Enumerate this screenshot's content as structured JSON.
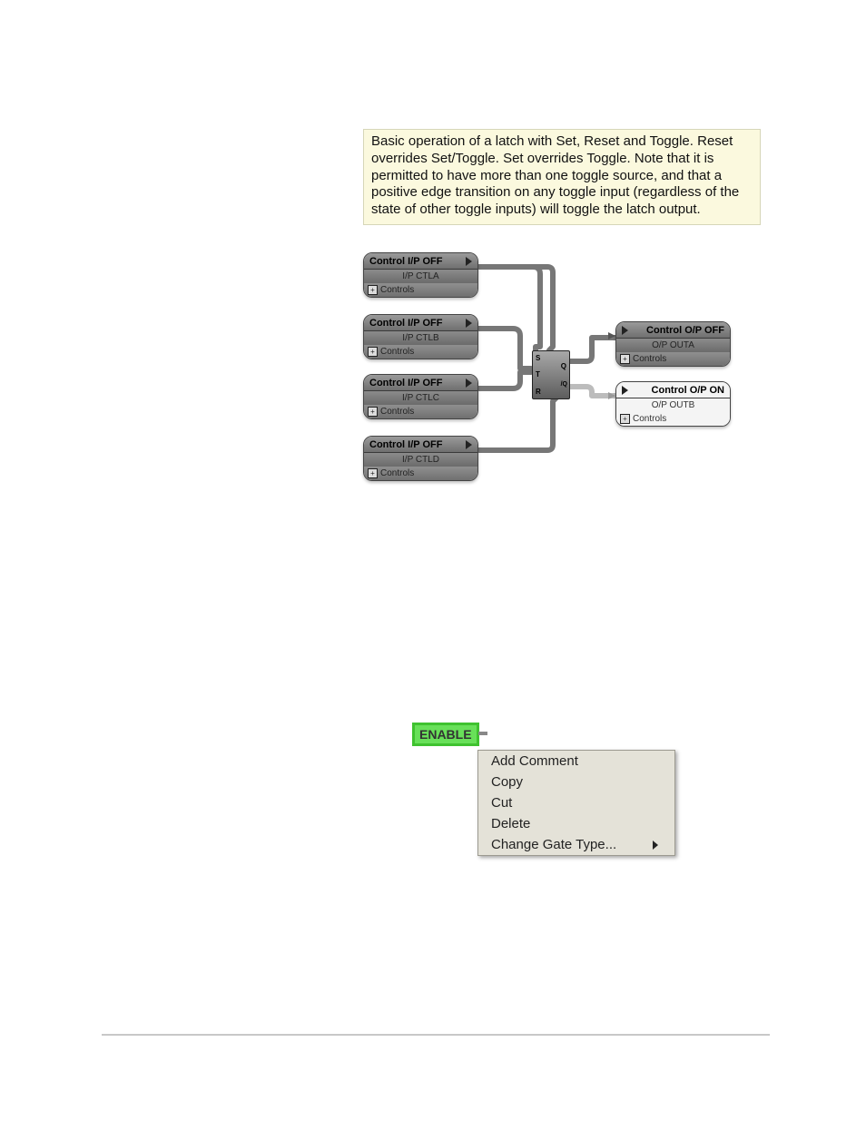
{
  "note": {
    "text": "Basic operation of a latch with Set, Reset and Toggle. Reset overrides Set/Toggle. Set overrides Toggle. Note that it is permitted to have more than one toggle source, and that a positive edge transition on any toggle input (regardless of the state of other toggle inputs) will toggle the latch output."
  },
  "inputs": [
    {
      "title": "Control I/P OFF",
      "sub": "I/P CTLA",
      "controls": "Controls"
    },
    {
      "title": "Control I/P OFF",
      "sub": "I/P CTLB",
      "controls": "Controls"
    },
    {
      "title": "Control I/P OFF",
      "sub": "I/P CTLC",
      "controls": "Controls"
    },
    {
      "title": "Control I/P OFF",
      "sub": "I/P CTLD",
      "controls": "Controls"
    }
  ],
  "outputs": [
    {
      "title": "Control O/P OFF",
      "sub": "O/P OUTA",
      "controls": "Controls",
      "white": false
    },
    {
      "title": "Control O/P ON",
      "sub": "O/P OUTB",
      "controls": "Controls",
      "white": true
    }
  ],
  "latch": {
    "pins": {
      "s": "S",
      "t": "T",
      "r": "R",
      "q": "Q",
      "nq": "/Q"
    }
  },
  "gate": {
    "label": "ENABLE"
  },
  "menu": {
    "items": [
      {
        "label": "Add Comment",
        "submenu": false
      },
      {
        "label": "Copy",
        "submenu": false
      },
      {
        "label": "Cut",
        "submenu": false
      },
      {
        "label": "Delete",
        "submenu": false
      },
      {
        "label": "Change Gate Type...",
        "submenu": true
      }
    ]
  }
}
